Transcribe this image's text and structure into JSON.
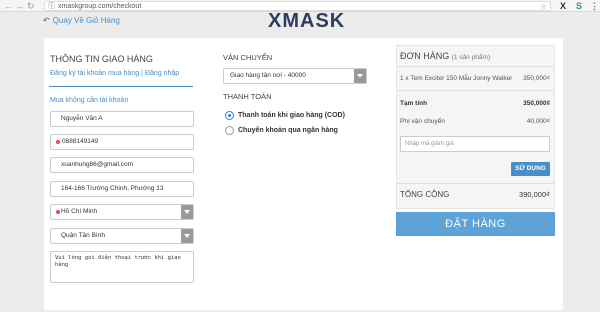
{
  "browser": {
    "url": "xmaskgroup.com/checkout",
    "ext_x_label": "X",
    "ext_s_label": "S"
  },
  "header": {
    "back_label": "Quay Về Giỏ Hàng",
    "brand": "XMASK"
  },
  "shipping_info": {
    "title": "THÔNG TIN GIAO HÀNG",
    "register_link": "Đăng ký tài khoản mua hàng",
    "separator": "|",
    "login_link": "Đăng nhập",
    "guest_label": "Mua không cần tài khoản",
    "name_value": "Nguyễn Văn A",
    "phone_value": "0888149149",
    "email_value": "xuanhung86@gmail.com",
    "address_value": "164-166 Trường Chinh, Phường 13",
    "city_value": "Hồ Chí Minh",
    "district_value": "Quận Tân Bình",
    "note_value": "Vui lòng gọi điện thoại trước khi giao hàng"
  },
  "shipping_method": {
    "title": "VẬN CHUYỂN",
    "selected": "Giao hàng tận nơi - 40000"
  },
  "payment": {
    "title": "THANH TOÁN",
    "options": [
      {
        "label": "Thanh toán khi giao hàng (COD)",
        "selected": true
      },
      {
        "label": "Chuyển khoản qua ngân hàng",
        "selected": false
      }
    ]
  },
  "order": {
    "title": "ĐƠN HÀNG",
    "count_label": "(1 sản phẩm)",
    "item_name": "1 x Tem Exciter 150 Mẫu Jonny Walker",
    "item_price": "350,000₫",
    "subtotal_label": "Tạm tính",
    "subtotal_value": "350,000₫",
    "shipping_label": "Phí vận chuyển",
    "shipping_value": "40,000₫",
    "coupon_placeholder": "Nhập mã giảm giá",
    "apply_label": "SỬ DỤNG",
    "total_label": "TỔNG CỘNG",
    "total_value": "390,000₫",
    "checkout_label": "ĐẶT HÀNG"
  },
  "colors": {
    "accent": "#4a8ec7",
    "brand": "#2c3e62",
    "checkout_button": "#5da3d8",
    "required_dot": "#e05050"
  }
}
